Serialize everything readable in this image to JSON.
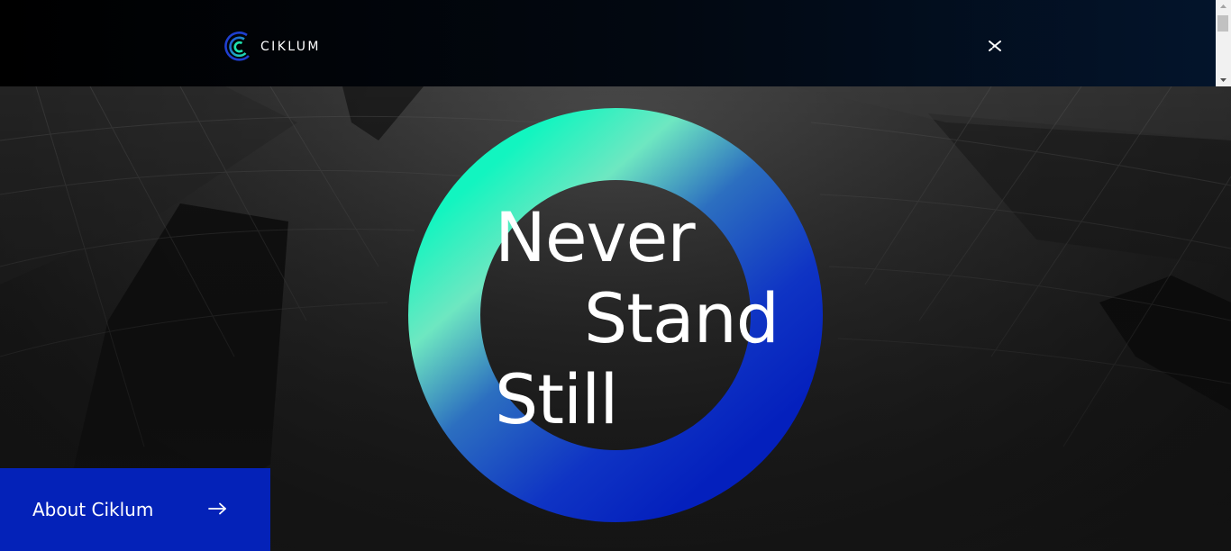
{
  "header": {
    "logo_text": "CIKLUM",
    "close_icon": "close-icon"
  },
  "hero": {
    "headline": {
      "line1": "Never",
      "line2": "Stand",
      "line3": "Still"
    },
    "ring_colors": {
      "start": "#12f5c0",
      "end": "#0622c2"
    }
  },
  "cta": {
    "label": "About Ciklum",
    "icon": "arrow-right-icon"
  },
  "colors": {
    "cta_background": "#0422b8",
    "header_background": "#000000"
  }
}
